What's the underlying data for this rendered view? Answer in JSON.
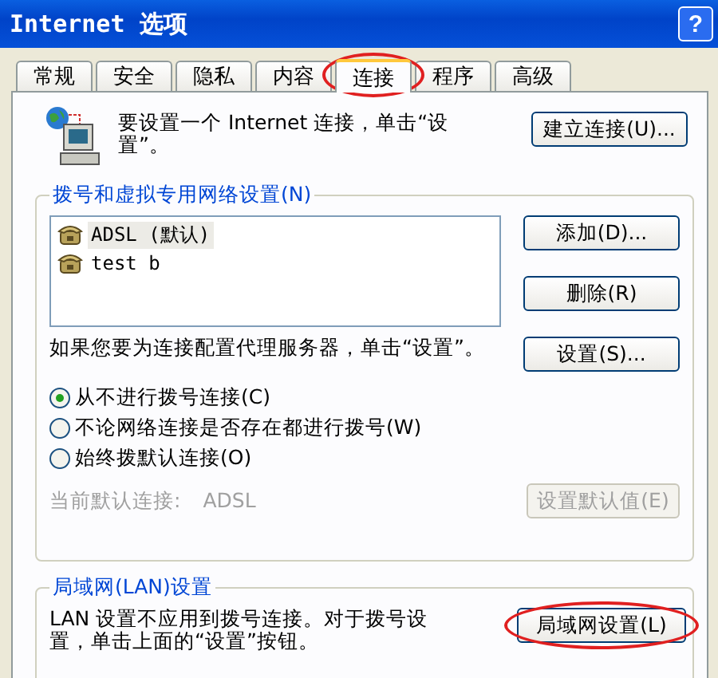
{
  "window": {
    "title": "Internet 选项",
    "help_button": "?"
  },
  "tabs": [
    {
      "label": "常规",
      "selected": false,
      "circled": false
    },
    {
      "label": "安全",
      "selected": false,
      "circled": false
    },
    {
      "label": "隐私",
      "selected": false,
      "circled": false
    },
    {
      "label": "内容",
      "selected": false,
      "circled": false
    },
    {
      "label": "连接",
      "selected": true,
      "circled": true
    },
    {
      "label": "程序",
      "selected": false,
      "circled": false
    },
    {
      "label": "高级",
      "selected": false,
      "circled": false
    }
  ],
  "setup": {
    "text": "要设置一个 Internet 连接，单击“设置”。",
    "button": "建立连接(U)..."
  },
  "dialup": {
    "title": "拨号和虚拟专用网络设置(N)",
    "connections": [
      {
        "name": "ADSL (默认)",
        "selected": true
      },
      {
        "name": "test b",
        "selected": false
      }
    ],
    "buttons": [
      {
        "label": "添加(D)...",
        "disabled": false
      },
      {
        "label": "删除(R)",
        "disabled": false
      },
      {
        "label": "设置(S)...",
        "disabled": false
      }
    ],
    "proxy_text": "如果您要为连接配置代理服务器，单击“设置”。",
    "options": [
      {
        "label": "从不进行拨号连接(C)",
        "selected": true
      },
      {
        "label": "不论网络连接是否存在都进行拨号(W)",
        "selected": false
      },
      {
        "label": "始终拨默认连接(O)",
        "selected": false
      }
    ],
    "current_label": "当前默认连接:",
    "current_value": "ADSL",
    "default_button": {
      "label": "设置默认值(E)",
      "disabled": true
    }
  },
  "lan": {
    "title": "局域网(LAN)设置",
    "text": "LAN 设置不应用到拨号连接。对于拨号设置，单击上面的“设置”按钮。",
    "button": {
      "label": "局域网设置(L)",
      "circled": true
    }
  }
}
